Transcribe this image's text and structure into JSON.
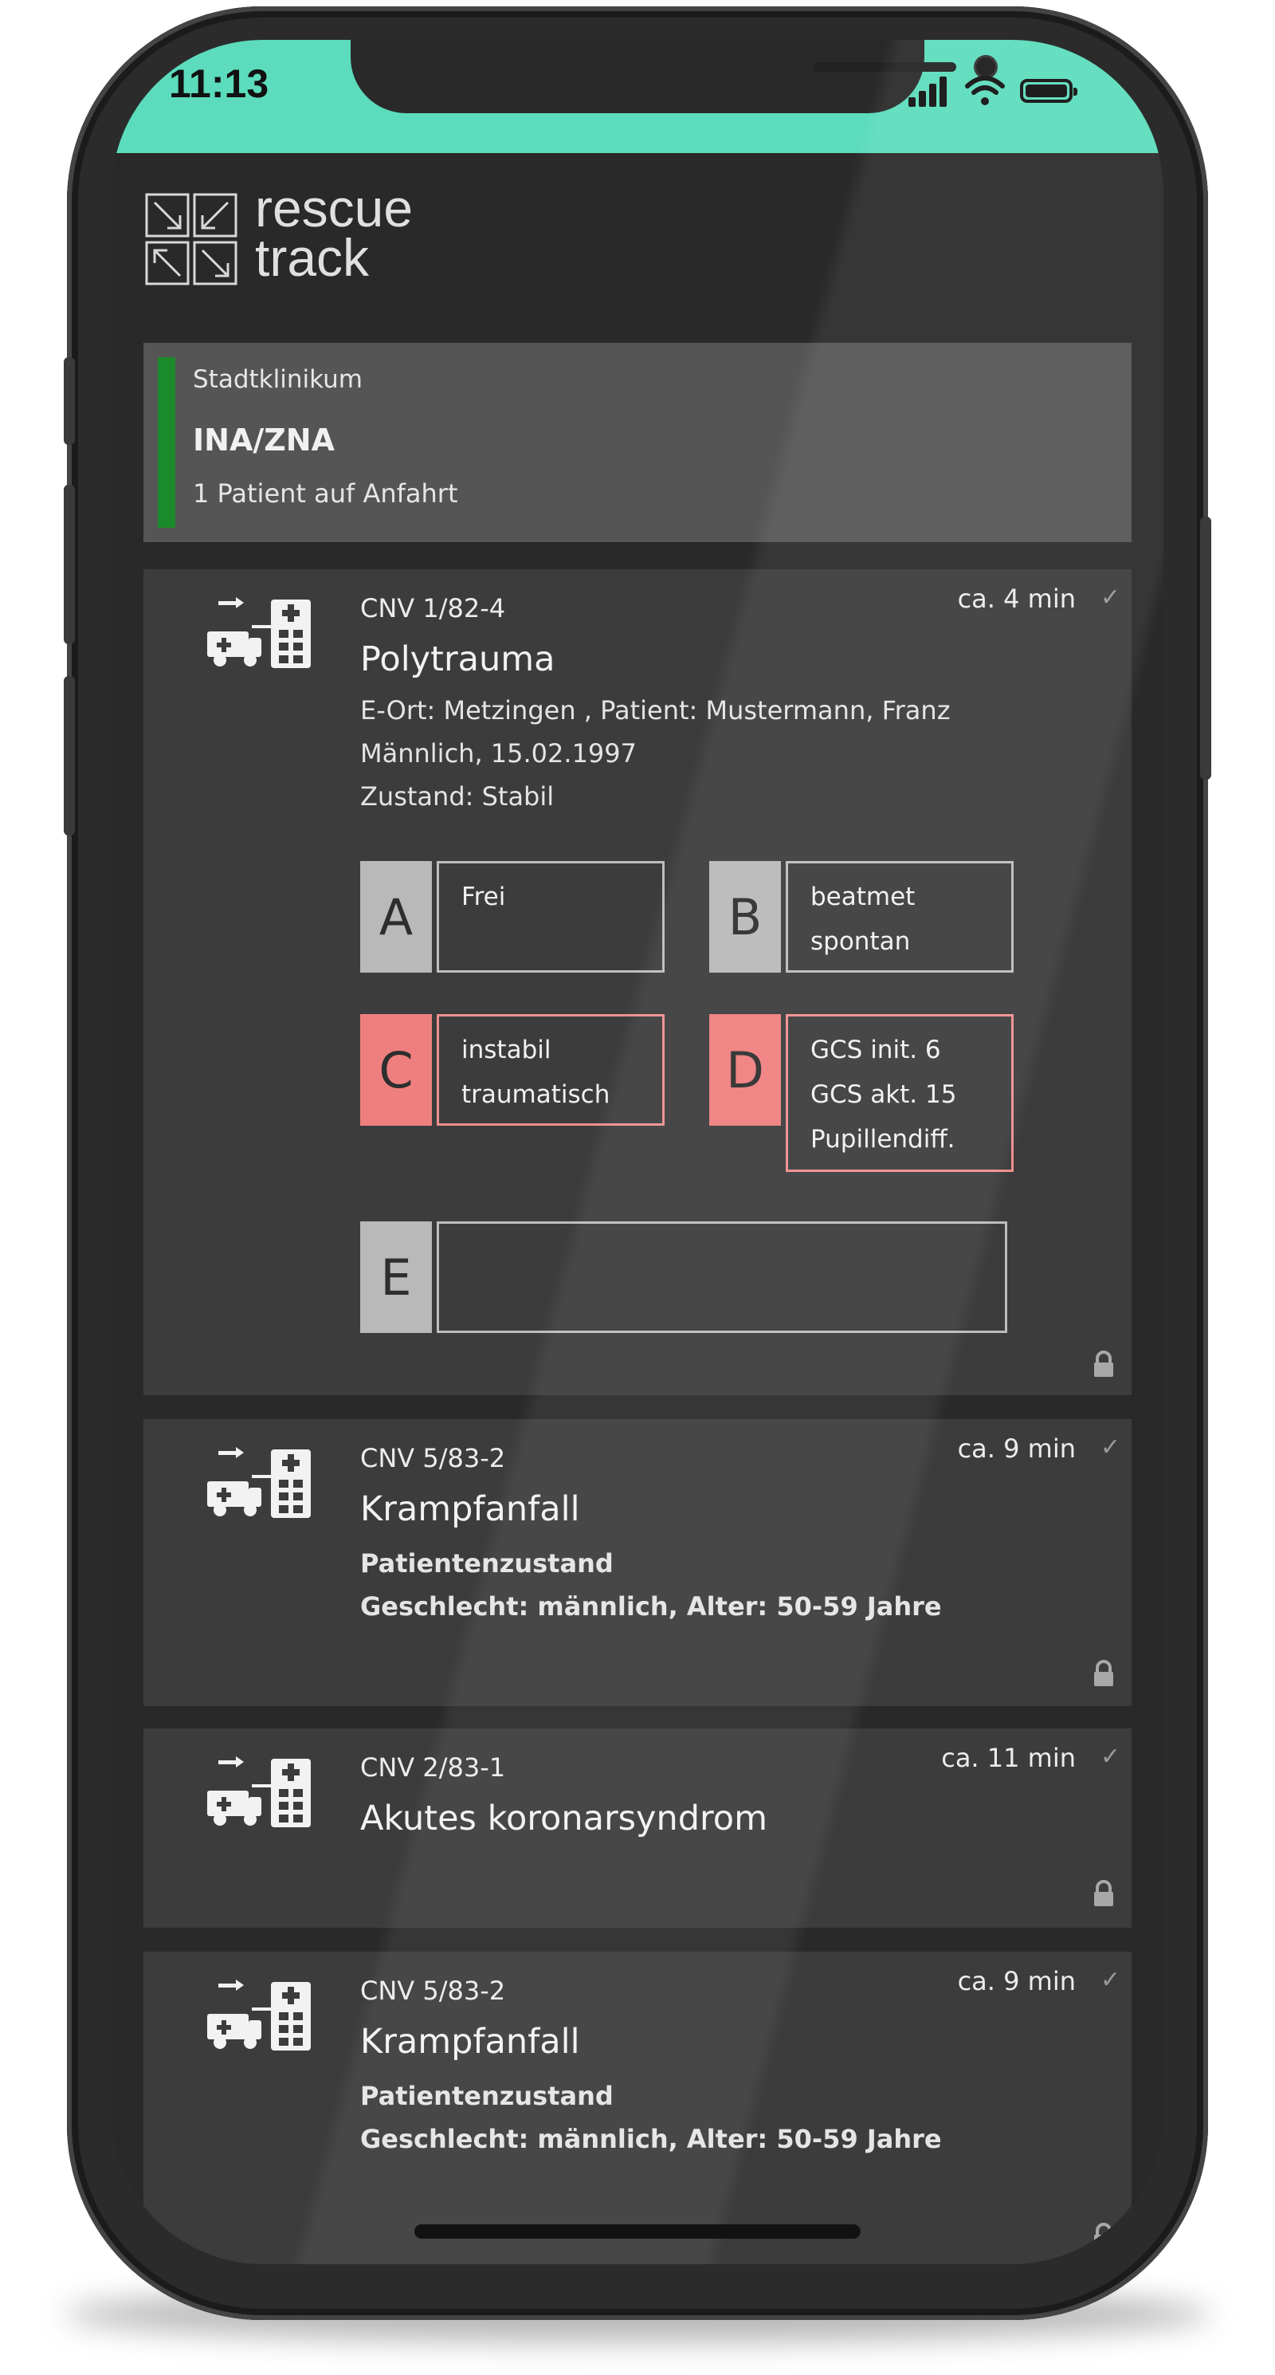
{
  "status_bar": {
    "time": "11:13",
    "icons": [
      "signal-icon",
      "wifi-icon",
      "battery-icon"
    ],
    "color": "#5cdcbc"
  },
  "logo": {
    "line1": "rescue",
    "line2": "track"
  },
  "hospital": {
    "name": "Stadtklinikum",
    "unit": "INA/ZNA",
    "summary": "1 Patient auf Anfahrt",
    "accent": "#1b8a2a"
  },
  "cards": [
    {
      "id": "CNV 1/82-4",
      "eta": "ca. 4 min",
      "diagnosis": "Polytrauma",
      "details": [
        "E-Ort: Metzingen , Patient: Mustermann, Franz",
        "Männlich, 15.02.1997",
        "Zustand: Stabil"
      ],
      "abcde": [
        {
          "letter": "A",
          "text": [
            "Frei"
          ],
          "status": "normal"
        },
        {
          "letter": "B",
          "text": [
            "beatmet",
            "spontan"
          ],
          "status": "normal"
        },
        {
          "letter": "C",
          "text": [
            "instabil",
            "traumatisch"
          ],
          "status": "critical"
        },
        {
          "letter": "D",
          "text": [
            "GCS init. 6",
            "GCS akt. 15",
            "Pupillendiff."
          ],
          "status": "critical"
        },
        {
          "letter": "E",
          "text": [],
          "status": "normal"
        }
      ]
    },
    {
      "id": "CNV 5/83-2",
      "eta": "ca. 9 min",
      "diagnosis": "Krampfanfall",
      "details": [
        "Patientenzustand",
        "Geschlecht: männlich, Alter: 50-59 Jahre"
      ]
    },
    {
      "id": "CNV 2/83-1",
      "eta": "ca. 11 min",
      "diagnosis": "Akutes koronarsyndrom",
      "details": []
    },
    {
      "id": "CNV 5/83-2",
      "eta": "ca. 9 min",
      "diagnosis": "Krampfanfall",
      "details": [
        "Patientenzustand",
        "Geschlecht: männlich, Alter: 50-59 Jahre"
      ]
    }
  ],
  "colors": {
    "critical": "#ef7f7f",
    "normal": "#b9b9b9",
    "card_bg": "#3c3c3c"
  }
}
